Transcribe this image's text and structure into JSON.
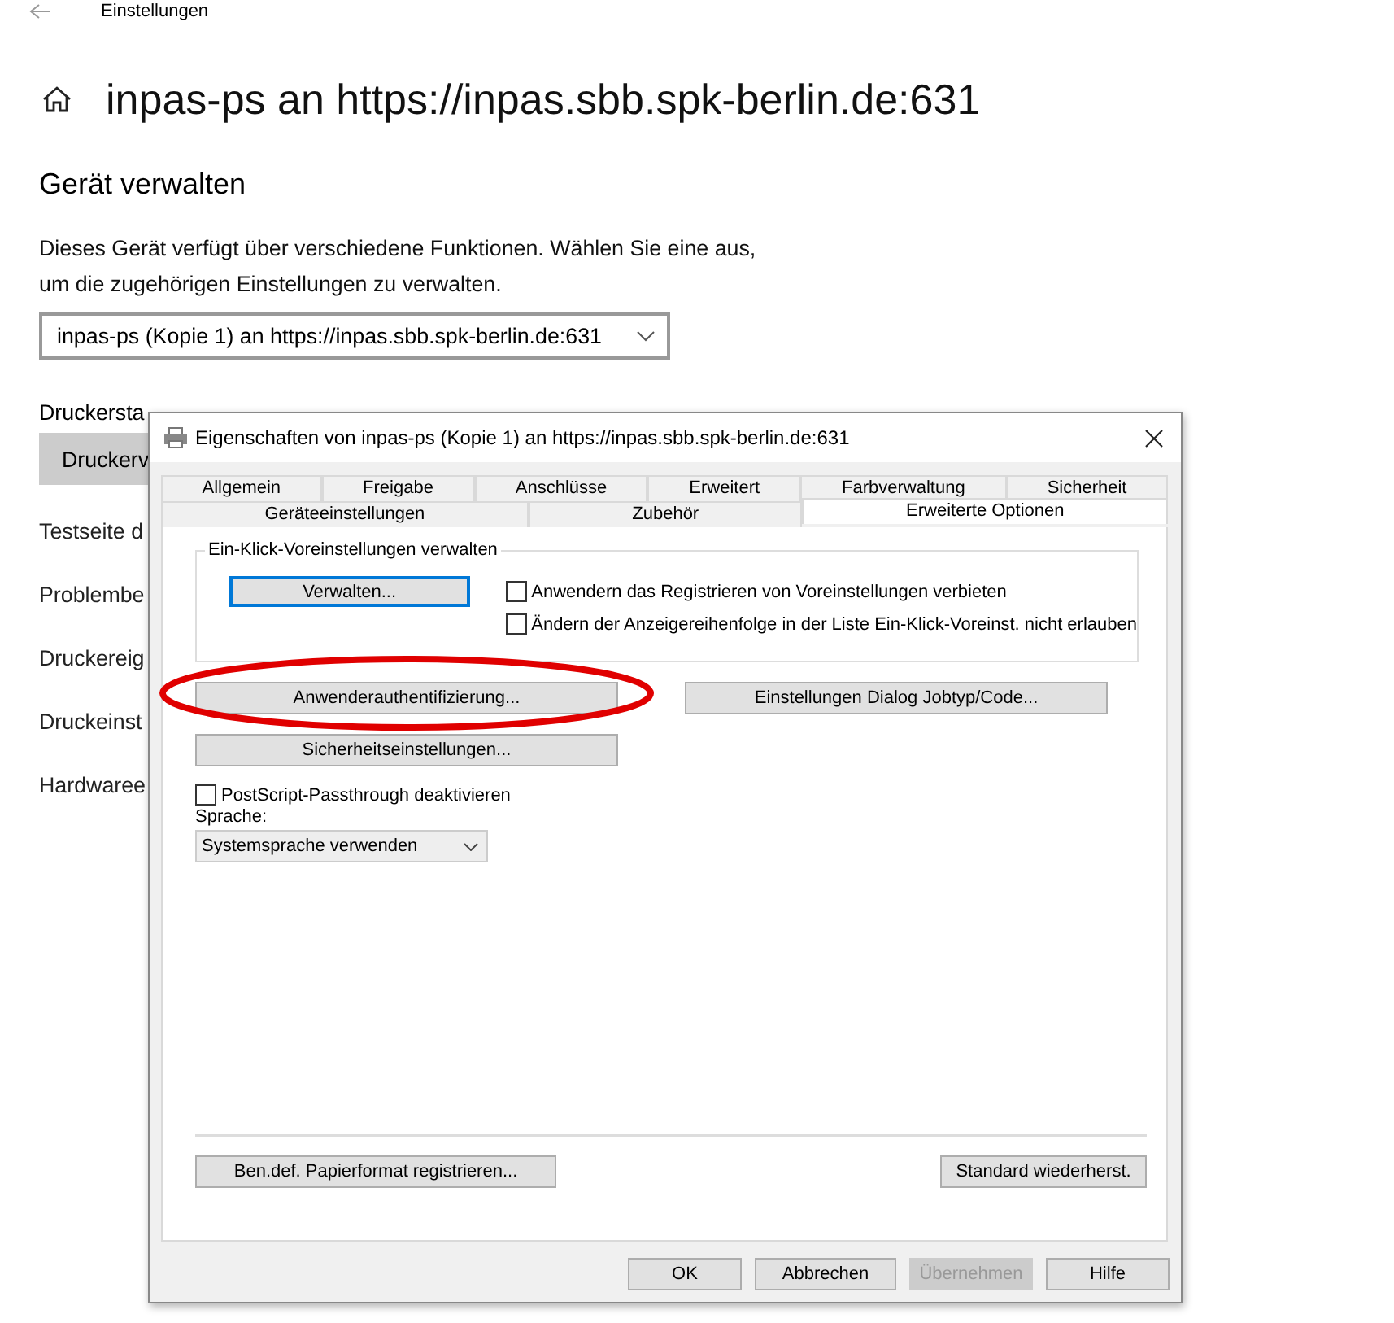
{
  "settings_page": {
    "breadcrumb": "Einstellungen",
    "title": "inpas-ps an https://inpas.sbb.spk-berlin.de:631",
    "section_title": "Gerät verwalten",
    "description": "Dieses Gerät verfügt über verschiedene Funktionen. Wählen Sie eine aus, um die zugehörigen Einstellungen zu verwalten.",
    "device_select": {
      "value": "inpas-ps (Kopie 1) an https://inpas.sbb.spk-berlin.de:631"
    },
    "status_label": "Druckersta",
    "manage_button": "Druckerv",
    "links": [
      "Testseite d",
      "Problembe",
      "Druckereig",
      "Druckeinst",
      "Hardwaree"
    ]
  },
  "dialog": {
    "title": "Eigenschaften von inpas-ps (Kopie 1) an https://inpas.sbb.spk-berlin.de:631",
    "tab_rows": [
      [
        {
          "label": "Allgemein",
          "selected": false
        },
        {
          "label": "Freigabe",
          "selected": false
        },
        {
          "label": "Anschlüsse",
          "selected": false
        },
        {
          "label": "Erweitert",
          "selected": false
        },
        {
          "label": "Farbverwaltung",
          "selected": false
        },
        {
          "label": "Sicherheit",
          "selected": false
        }
      ],
      [
        {
          "label": "Geräteeinstellungen",
          "selected": false
        },
        {
          "label": "Zubehör",
          "selected": false
        },
        {
          "label": "Erweiterte Optionen",
          "selected": true
        }
      ]
    ],
    "group": {
      "title": "Ein-Klick-Voreinstellungen verwalten",
      "button": "Verwalten...",
      "checkboxes": [
        {
          "label": "Anwendern das Registrieren von Voreinstellungen verbieten",
          "checked": false
        },
        {
          "label": "Ändern der Anzeigereihenfolge in der Liste Ein-Klick-Voreinst. nicht erlauben",
          "checked": false
        }
      ]
    },
    "button_rows": [
      [
        "Anwenderauthentifizierung...",
        "Einstellungen Dialog Jobtyp/Code..."
      ],
      [
        "Sicherheitseinstellungen..."
      ]
    ],
    "passthrough": {
      "label": "PostScript-Passthrough deaktivieren",
      "checked": false
    },
    "language": {
      "label": "Sprache:",
      "value": "Systemsprache verwenden"
    },
    "footer_buttons": [
      "Ben.def. Papierformat registrieren...",
      "Standard wiederherst."
    ],
    "dialog_buttons": [
      {
        "label": "OK",
        "disabled": false
      },
      {
        "label": "Abbrechen",
        "disabled": false
      },
      {
        "label": "Übernehmen",
        "disabled": true
      },
      {
        "label": "Hilfe",
        "disabled": false
      }
    ]
  },
  "annotations": [
    {
      "kind": "ellipse"
    }
  ]
}
